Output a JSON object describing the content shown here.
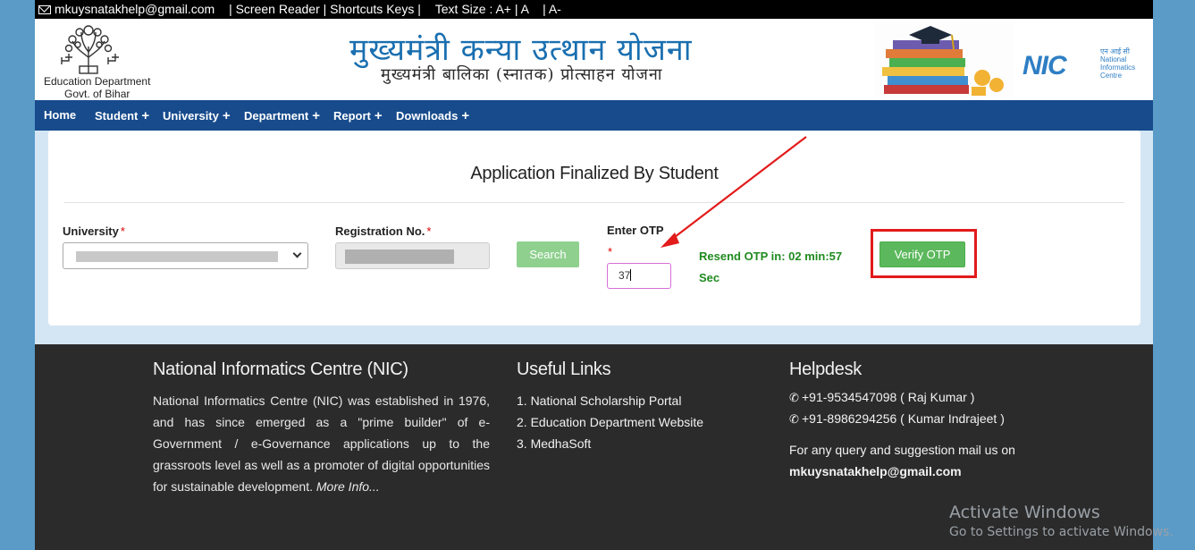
{
  "topbar": {
    "email": "mkuysnatakhelp@gmail.com",
    "links": "| Screen Reader | Shortcuts Keys |",
    "text_size": "Text Size : A+ | A",
    "text_small": "|   A-"
  },
  "header": {
    "title_hindi": "मुख्यमंत्री कन्या उत्थान योजना",
    "subtitle_hindi": "मुख्यमंत्री बालिका (स्नातक) प्रोत्साहन योजना",
    "dept_line1": "Education Department",
    "dept_line2": "Govt. of Bihar",
    "nic_logo": "NIC",
    "nic_caption": "एन आई सी National Informatics Centre"
  },
  "nav": {
    "items": [
      {
        "label": "Home",
        "has_plus": false
      },
      {
        "label": "Student",
        "has_plus": true
      },
      {
        "label": "University",
        "has_plus": true
      },
      {
        "label": "Department",
        "has_plus": true
      },
      {
        "label": "Report",
        "has_plus": true
      },
      {
        "label": "Downloads",
        "has_plus": true
      }
    ],
    "plus": "+"
  },
  "form": {
    "title": "Application Finalized By Student",
    "university_label": "University",
    "registration_label": "Registration No.",
    "required_mark": "*",
    "search_label": "Search",
    "otp_label": "Enter OTP",
    "otp_value": "37",
    "resend_line1": "Resend OTP in: 02 min:57",
    "resend_line2": "Sec",
    "verify_label": "Verify OTP"
  },
  "footer": {
    "about_heading": "National Informatics Centre (NIC)",
    "about_text": "National Informatics Centre (NIC) was established in 1976, and has since emerged as a \"prime builder\" of e-Government / e-Governance applications up to the grassroots level as well as a promoter of digital opportunities for sustainable development.",
    "more_info": "More Info...",
    "links_heading": "Useful Links",
    "links": [
      "1. National Scholarship Portal",
      "2. Education Department Website",
      "3. MedhaSoft"
    ],
    "help_heading": "Helpdesk",
    "phones": [
      "+91-9534547098 ( Raj Kumar )",
      "+91-8986294256 ( Kumar Indrajeet )"
    ],
    "query_text": "For any query and suggestion mail us on",
    "help_email": "mkuysnatakhelp@gmail.com"
  },
  "watermark": {
    "line1": "Activate Windows",
    "line2": "Go to Settings to activate Windows."
  },
  "colors": {
    "nav_bg": "#174b8c",
    "title_blue": "#1a6fb0",
    "verify_green": "#5cb85c",
    "resend_green": "#1f8a1f",
    "highlight_red": "#e21b1b",
    "footer_bg": "#2b2b2b"
  }
}
